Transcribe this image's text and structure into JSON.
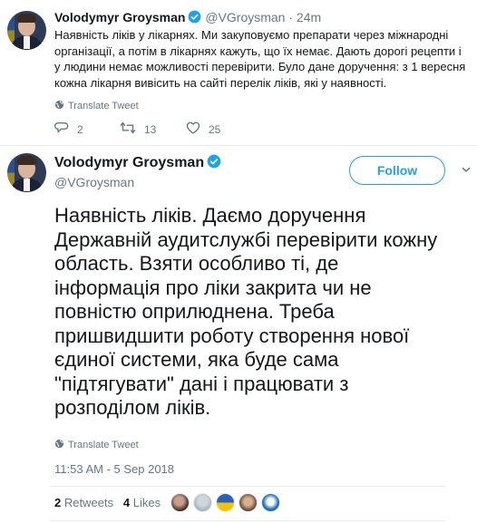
{
  "retweet": {
    "author_name": "Volodymyr Groysman",
    "handle": "@VGroysman",
    "time": "24m",
    "text": "Наявність ліків у лікарнях. Ми закуповуємо препарати через міжнародні організації, а потім в лікарнях кажуть, що їх немає. Дають дорогі рецепти і у людини немає можливості перевірити. Було дане доручення: з 1 вересня кожна лікарня вивісить на сайті перелік ліків, які у наявності.",
    "translate": "Translate Tweet",
    "replies": "2",
    "retweets": "13",
    "likes": "25"
  },
  "tweet": {
    "author_name": "Volodymyr Groysman",
    "handle": "@VGroysman",
    "follow_label": "Follow",
    "text": "Наявність ліків. Даємо доручення Державній аудитслужбі перевірити кожну область. Взяти особливо ті, де інформація про ліки закрита чи не повністю оприлюднена. Треба пришвидшити роботу створення нової єдиної системи, яка буде сама \"підтягувати\" дані і працювати з розподілом ліків.",
    "translate": "Translate Tweet",
    "timestamp": "11:53 AM - 5 Sep 2018",
    "retweet_count": "2",
    "retweet_label": "Retweets",
    "like_count": "4",
    "like_label": "Likes"
  },
  "icons": {
    "verified": "verified-badge-icon",
    "globe": "globe-icon",
    "reply": "reply-icon",
    "retweet": "retweet-icon",
    "like": "heart-icon",
    "more": "chevron-down-icon"
  },
  "colors": {
    "accent": "#1da1f2",
    "text": "#14171a",
    "muted": "#657786"
  }
}
